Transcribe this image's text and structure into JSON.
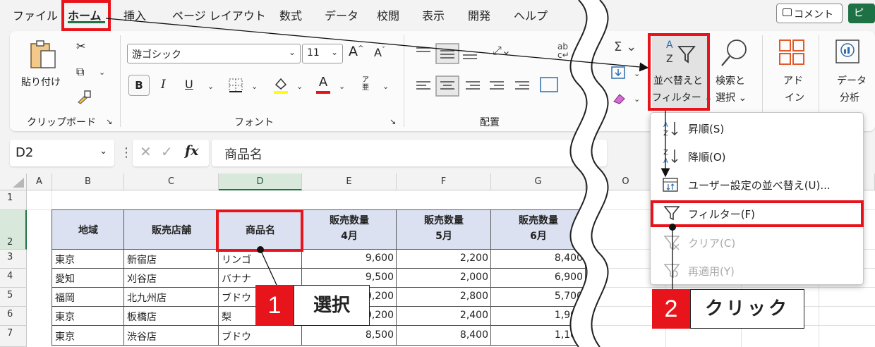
{
  "menubar": {
    "items": [
      "ファイル",
      "ホーム",
      "挿入",
      "ページ レイアウト",
      "数式",
      "データ",
      "校閲",
      "表示",
      "開発",
      "ヘルプ"
    ],
    "active": "ホーム",
    "comment_label": "コメント",
    "share_label": "ピ"
  },
  "ribbon": {
    "clipboard": {
      "paste_label": "貼り付け",
      "group_label": "クリップボード"
    },
    "font": {
      "font_name": "游ゴシック",
      "font_size": "11",
      "bold": "B",
      "italic": "I",
      "underline": "U",
      "underline_suffix": "U",
      "highlight_letter": "A",
      "furigana": "ア亜",
      "grow": "A",
      "shrink": "A",
      "group_label": "フォント"
    },
    "alignment": {
      "group_label": "配置"
    },
    "editing": {
      "sort_filter_line1": "並べ替えと",
      "sort_filter_line2": "フィルター ⌄",
      "find_select_line1": "検索と",
      "find_select_line2": "選択 ⌄",
      "addin_line1": "アド",
      "addin_line2": "イン",
      "analysis_line1": "データ",
      "analysis_line2": "分析"
    }
  },
  "formula_bar": {
    "name_box": "D2",
    "fx": "fx",
    "content": "商品名"
  },
  "sheet": {
    "columns": [
      "A",
      "B",
      "C",
      "D",
      "E",
      "F",
      "G",
      "O"
    ],
    "rows": [
      "1",
      "2",
      "3",
      "4",
      "5",
      "6",
      "7"
    ],
    "headers": {
      "region": "地域",
      "store": "販売店舗",
      "product": "商品名",
      "qty_label": "販売数量",
      "m4": "4月",
      "m5": "5月",
      "m6": "6月"
    },
    "data": [
      {
        "region": "東京",
        "store": "新宿店",
        "product": "リンゴ",
        "m4": "9,600",
        "m5": "2,200",
        "m6": "8,400"
      },
      {
        "region": "愛知",
        "store": "刈谷店",
        "product": "バナナ",
        "m4": "9,500",
        "m5": "2,000",
        "m6": "6,900"
      },
      {
        "region": "福岡",
        "store": "北九州店",
        "product": "ブドウ",
        "m4": "9,200",
        "m5": "2,800",
        "m6": "5,700"
      },
      {
        "region": "東京",
        "store": "板橋店",
        "product": "梨",
        "m4": "9,200",
        "m5": "2,400",
        "m6": "1,900"
      },
      {
        "region": "東京",
        "store": "渋谷店",
        "product": "ブドウ",
        "m4": "8,500",
        "m5": "8,400",
        "m6": "1,100"
      }
    ]
  },
  "sort_menu": {
    "items": [
      {
        "label": "昇順(S)",
        "icon": "sort-ascending-icon",
        "disabled": false
      },
      {
        "label": "降順(O)",
        "icon": "sort-descending-icon",
        "disabled": false
      },
      {
        "label": "ユーザー設定の並べ替え(U)...",
        "icon": "custom-sort-icon",
        "disabled": false
      },
      {
        "label": "フィルター(F)",
        "icon": "filter-icon",
        "disabled": false
      },
      {
        "label": "クリア(C)",
        "icon": "clear-filter-icon",
        "disabled": true
      },
      {
        "label": "再適用(Y)",
        "icon": "reapply-filter-icon",
        "disabled": true
      }
    ]
  },
  "callouts": {
    "step1_number": "1",
    "step1_label": "選択",
    "step2_number": "2",
    "step2_label": "クリック"
  },
  "colors": {
    "highlight_red": "#e8141b",
    "excel_green": "#217346",
    "header_fill": "#dbe1f1"
  }
}
